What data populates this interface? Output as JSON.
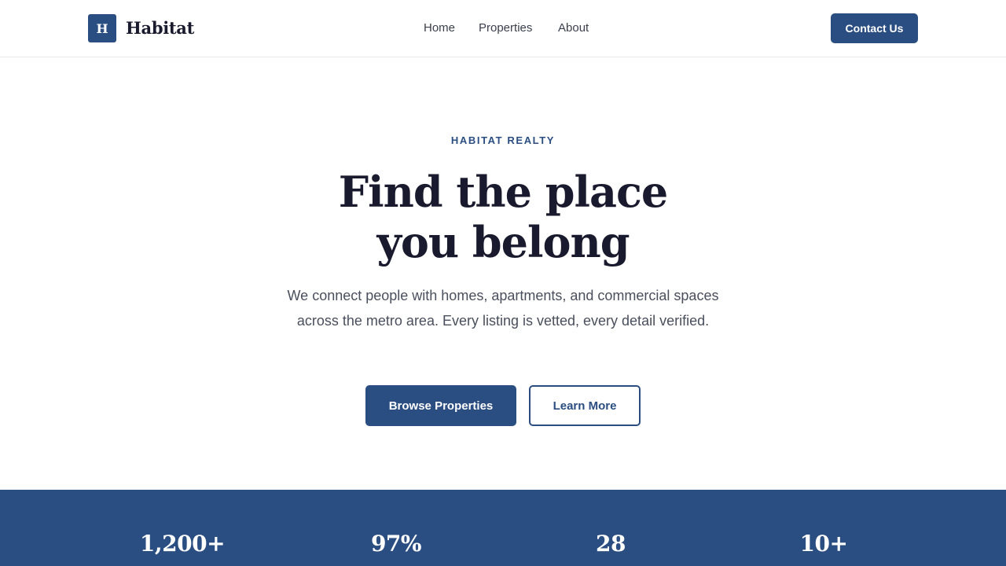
{
  "header": {
    "logo_mark": "H",
    "brand": "Habitat",
    "nav": [
      "Home",
      "Properties",
      "About"
    ],
    "contact_label": "Contact Us"
  },
  "hero": {
    "eyebrow": "HABITAT REALTY",
    "headline_line1": "Find the place",
    "headline_line2": "you belong",
    "lede": "We connect people with homes, apartments, and commercial spaces across the metro area. Every listing is vetted, every detail verified.",
    "primary_cta": "Browse Properties",
    "secondary_cta": "Learn More"
  },
  "stats": [
    "1,200+",
    "97%",
    "28",
    "10+"
  ],
  "colors": {
    "brand": "#2b4e82",
    "heading": "#1a1a2e",
    "body_text": "#4a4f5c"
  }
}
